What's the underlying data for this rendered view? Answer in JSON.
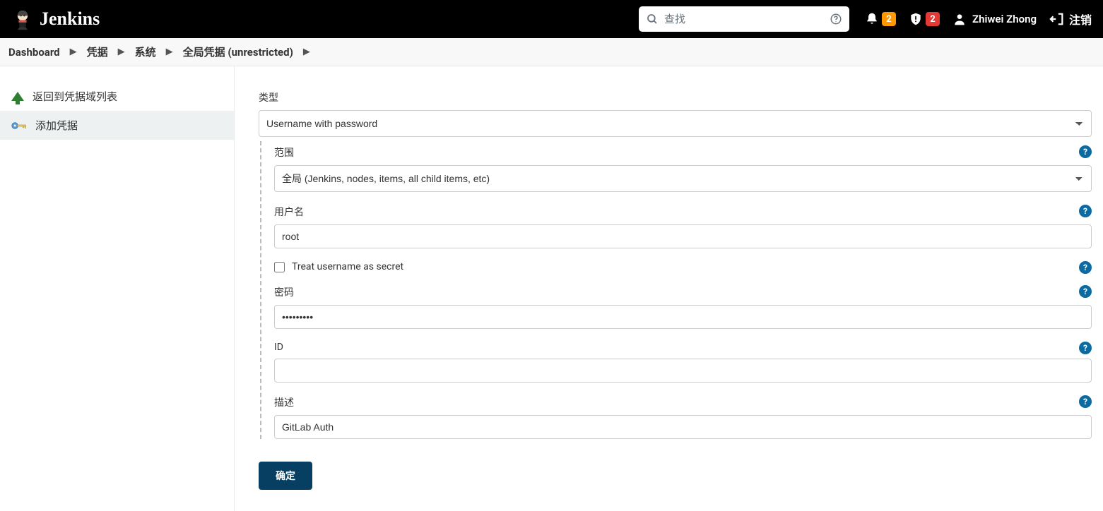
{
  "header": {
    "brand": "Jenkins",
    "search_placeholder": "查找",
    "notif_count": "2",
    "warn_count": "2",
    "user_name": "Zhiwei Zhong",
    "logout_label": "注销"
  },
  "breadcrumbs": {
    "items": [
      {
        "label": "Dashboard"
      },
      {
        "label": "凭据"
      },
      {
        "label": "系统"
      },
      {
        "label": "全局凭据 (unrestricted)"
      }
    ]
  },
  "sidebar": {
    "items": [
      {
        "label": "返回到凭据域列表"
      },
      {
        "label": "添加凭据"
      }
    ]
  },
  "form": {
    "type_label": "类型",
    "type_value": "Username with password",
    "scope_label": "范围",
    "scope_value": "全局 (Jenkins, nodes, items, all child items, etc)",
    "username_label": "用户名",
    "username_value": "root",
    "secret_checkbox_label": "Treat username as secret",
    "password_label": "密码",
    "password_value": "•••••••••",
    "id_label": "ID",
    "id_value": "",
    "description_label": "描述",
    "description_value": "GitLab Auth",
    "submit_label": "确定"
  },
  "colors": {
    "badge_orange": "#ff9800",
    "badge_red": "#e53935",
    "help_blue": "#0b6aa2",
    "primary_btn": "#063f61"
  }
}
